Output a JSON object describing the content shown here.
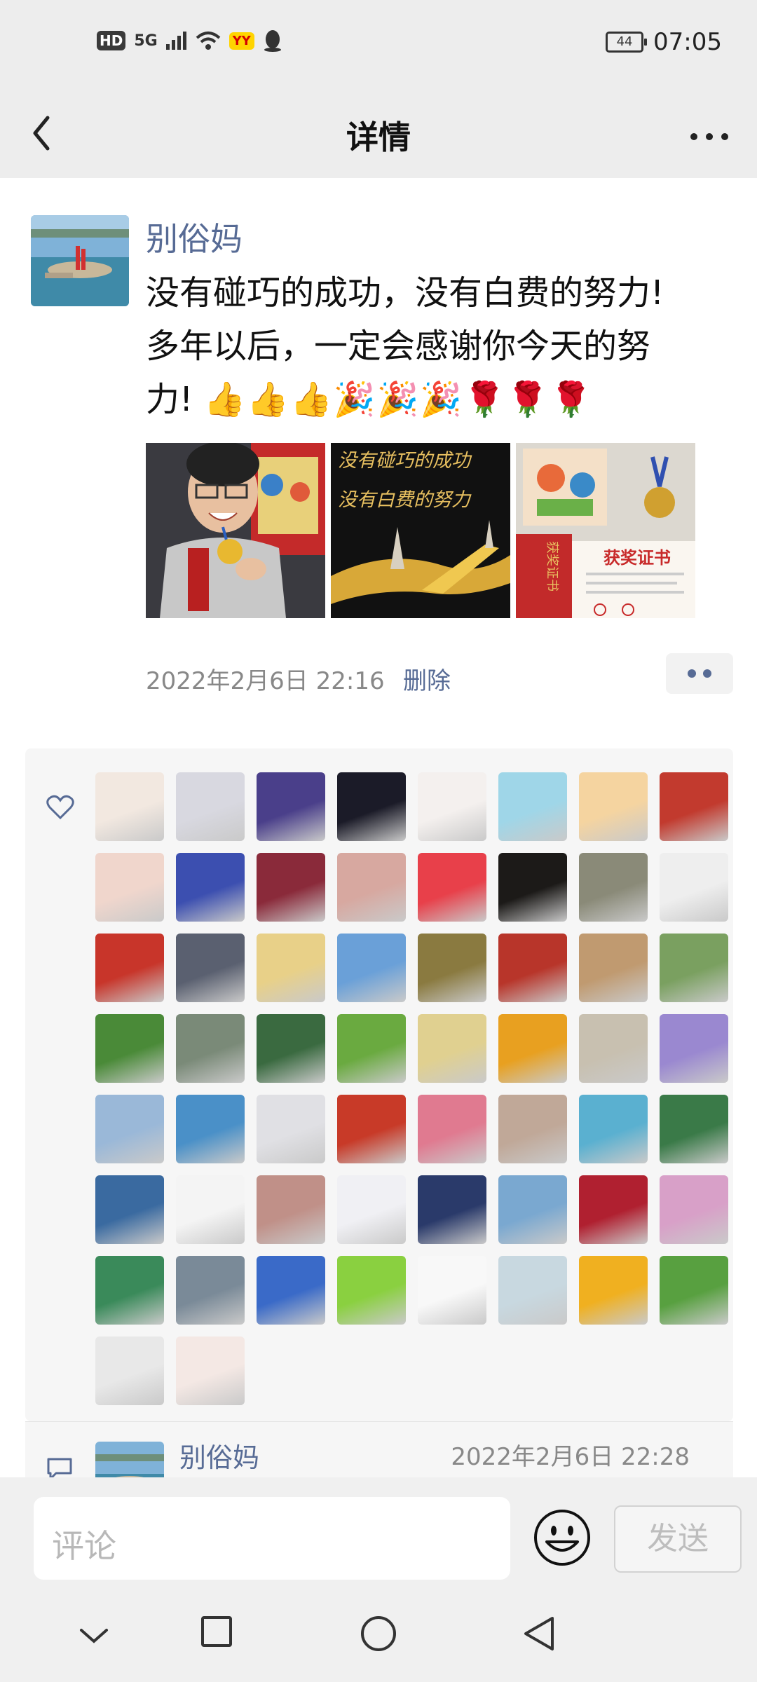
{
  "status_bar": {
    "hd_badge": "HD",
    "signal": "5G",
    "yy_badge": "YY",
    "battery": "44",
    "time": "07:05"
  },
  "nav": {
    "title": "详情"
  },
  "post": {
    "author": "别俗妈",
    "text_line1": "没有碰巧的成功，没有白费的努力!",
    "text_line2": "多年以后，一定会感谢你今天的努",
    "text_line3": "力!",
    "emoji_line": "👍👍👍🎉🎉🎉🌹🌹🌹",
    "photos": [
      {
        "name": "photo-boy-medal"
      },
      {
        "name": "photo-motto",
        "line1": "没有碰巧的成功",
        "line2": "没有白费的努力"
      },
      {
        "name": "photo-certificate",
        "title": "获奖证书",
        "side": "获奖证书"
      }
    ],
    "timestamp": "2022年2月6日 22:16",
    "delete_label": "删除"
  },
  "likes": {
    "count_shown": 58,
    "avatar_colors": [
      "#f2e8e0",
      "#d8d8e0",
      "#4a3f8a",
      "#1b1b28",
      "#f4f0ee",
      "#9fd6e8",
      "#f5d4a0",
      "#c23a2e",
      "#f0d6cc",
      "#3c4fb0",
      "#8a2a3a",
      "#d7a8a0",
      "#e8404a",
      "#1c1a18",
      "#8a8a78",
      "#eeeeee",
      "#c8352a",
      "#5a6070",
      "#e8d088",
      "#6aa0d8",
      "#8a7a40",
      "#b8352a",
      "#c09a70",
      "#7aa060",
      "#4a8a38",
      "#7a8a78",
      "#3a6a40",
      "#6aaa40",
      "#e0d090",
      "#e8a020",
      "#c8c0b0",
      "#9a88d0",
      "#9ab8d8",
      "#4a90c8",
      "#e0e0e4",
      "#c83a28",
      "#e07a90",
      "#c0a898",
      "#5ab0d0",
      "#3a7a48",
      "#3a6aa0",
      "#f4f4f4",
      "#c09088",
      "#f0f0f4",
      "#2a3a6a",
      "#7aa8d0",
      "#b02030",
      "#d8a0c8",
      "#3a8a5a",
      "#7a8a98",
      "#3a6ac8",
      "#8ad040",
      "#f8f8f8",
      "#c8d8e0",
      "#f0b020",
      "#58a040",
      "#e8e8e8",
      "#f4e8e4"
    ]
  },
  "comment": {
    "author": "别俗妈",
    "timestamp": "2022年2月6日 22:28"
  },
  "composer": {
    "placeholder": "评论",
    "send_label": "发送"
  }
}
